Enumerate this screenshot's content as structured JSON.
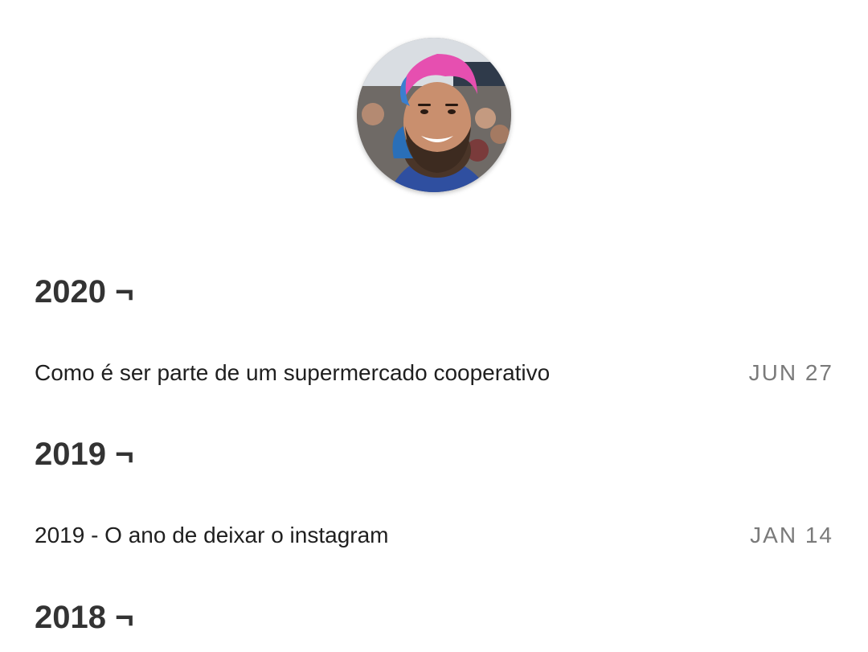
{
  "profile": {
    "avatar_alt": "profile-photo"
  },
  "sections": [
    {
      "year_label": "2020 ¬",
      "posts": [
        {
          "title": "Como é ser parte de um supermercado cooperativo",
          "date": "JUN 27"
        }
      ]
    },
    {
      "year_label": "2019 ¬",
      "posts": [
        {
          "title": "2019 - O ano de deixar o instagram",
          "date": "JAN 14"
        }
      ]
    },
    {
      "year_label": "2018 ¬",
      "posts": []
    }
  ],
  "colors": {
    "heading": "#333333",
    "post_title": "#1f1f1f",
    "post_date": "#7a7a7a",
    "background": "#ffffff"
  }
}
